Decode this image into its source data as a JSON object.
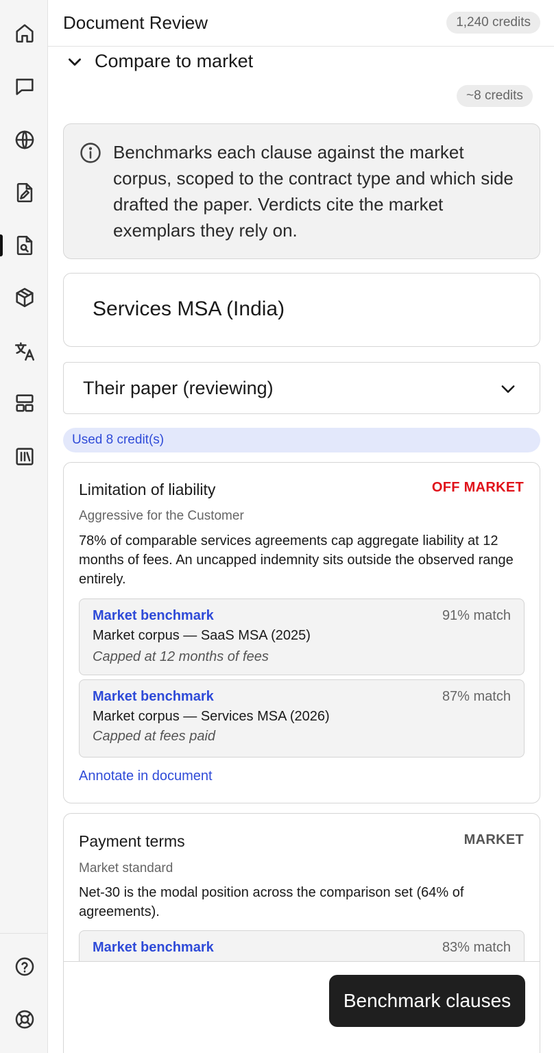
{
  "header": {
    "title": "Document Review",
    "credits": "1,240 credits"
  },
  "sidebar": {
    "top_items": [
      {
        "icon": "home-icon"
      },
      {
        "icon": "chat-icon"
      },
      {
        "icon": "globe-icon"
      },
      {
        "icon": "document-edit-icon"
      },
      {
        "icon": "document-search-icon",
        "active": true
      },
      {
        "icon": "cube-icon"
      },
      {
        "icon": "translate-icon"
      },
      {
        "icon": "layout-icon"
      },
      {
        "icon": "library-icon"
      }
    ],
    "bottom_items": [
      {
        "icon": "help-icon"
      },
      {
        "icon": "support-icon"
      }
    ]
  },
  "section": {
    "title": "Compare to market",
    "cost": "~8 credits",
    "info": "Benchmarks each clause against the market corpus, scoped to the contract type and which side drafted the paper. Verdicts cite the market exemplars they rely on."
  },
  "contract_type": "Services MSA (India)",
  "side_select": {
    "value": "Their paper (reviewing)"
  },
  "usage_notice": "Used 8 credit(s)",
  "clauses": [
    {
      "title": "Limitation of liability",
      "verdict": "OFF MARKET",
      "verdict_color": "#e0121a",
      "assessment": "Aggressive for the Customer",
      "explanation": "78% of comparable services agreements cap aggregate liability at 12 months of fees. An uncapped indemnity sits outside the observed range entirely.",
      "benchmarks": [
        {
          "label": "Market benchmark",
          "match": "91% match",
          "source": "Market corpus — SaaS MSA (2025)",
          "quote": "Capped at 12 months of fees"
        },
        {
          "label": "Market benchmark",
          "match": "87% match",
          "source": "Market corpus — Services MSA (2026)",
          "quote": "Capped at fees paid"
        }
      ],
      "action": "Annotate in document"
    },
    {
      "title": "Payment terms",
      "verdict": "MARKET",
      "verdict_color": "#555555",
      "assessment": "Market standard",
      "explanation": "Net-30 is the modal position across the comparison set (64% of agreements).",
      "benchmarks": [
        {
          "label": "Market benchmark",
          "match": "83% match"
        }
      ]
    }
  ],
  "primary_action": "Benchmark clauses",
  "colors": {
    "accent": "#2f4bd8",
    "off_market": "#e0121a",
    "usage_banner_bg": "#e3e8fb",
    "primary_button_bg": "#1f1f1f"
  }
}
